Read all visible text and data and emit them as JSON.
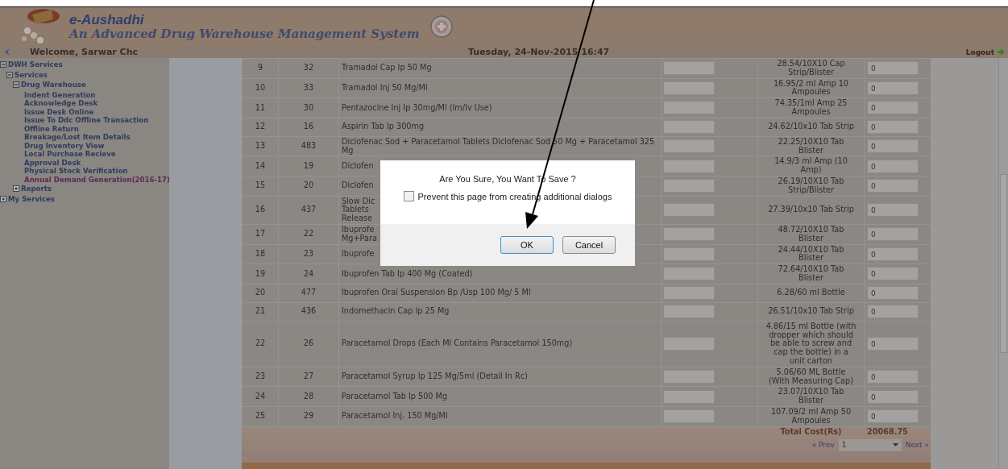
{
  "header": {
    "app_name": "e-Aushadhi",
    "tagline": "An Advanced Drug Warehouse Management System"
  },
  "welcome": "Welcome, Sarwar Chc",
  "datetime": "Tuesday, 24-Nov-2015 16:47",
  "logout": "Logout",
  "sidebar": {
    "items": [
      {
        "label": "DWH Services",
        "expanded": true,
        "children": [
          {
            "label": "Services",
            "expanded": true,
            "children": [
              {
                "label": "Drug Warehouse",
                "expanded": true,
                "children": [
                  {
                    "label": "Indent Generation",
                    "selected": false
                  },
                  {
                    "label": "Acknowledge Desk",
                    "selected": false
                  },
                  {
                    "label": "Issue Desk Online",
                    "selected": false
                  },
                  {
                    "label": "Issue To Ddc Offline Transaction",
                    "selected": false
                  },
                  {
                    "label": "Offline Return",
                    "selected": false
                  },
                  {
                    "label": "Breakage/Lost Item Details",
                    "selected": false
                  },
                  {
                    "label": "Drug Inventory View",
                    "selected": false
                  },
                  {
                    "label": "Local Purchase Recieve",
                    "selected": false
                  },
                  {
                    "label": "Approval Desk",
                    "selected": false
                  },
                  {
                    "label": "Physical Stock Verification",
                    "selected": false
                  },
                  {
                    "label": "Annual Demand Generation(2016-17)",
                    "selected": true
                  }
                ]
              },
              {
                "label": "Reports",
                "expanded": false
              }
            ]
          }
        ]
      },
      {
        "label": "My Services",
        "expanded": false
      }
    ]
  },
  "table": {
    "rows": [
      {
        "sno": "9",
        "code": "32",
        "name": "Tramadol Cap Ip 50 Mg",
        "rate": "28.54/10X10 Cap Strip/Blister",
        "qty": "0"
      },
      {
        "sno": "10",
        "code": "33",
        "name": "Tramadol Inj 50 Mg/Ml",
        "rate": "16.95/2 ml Amp 10 Ampoules",
        "qty": "0"
      },
      {
        "sno": "11",
        "code": "30",
        "name": "Pentazocine Inj Ip 30mg/Ml (Im/Iv Use)",
        "rate": "74.35/1ml Amp 25 Ampoules",
        "qty": "0"
      },
      {
        "sno": "12",
        "code": "16",
        "name": "Aspirin Tab Ip 300mg",
        "rate": "24.62/10x10 Tab Strip",
        "qty": "0"
      },
      {
        "sno": "13",
        "code": "483",
        "name": "Diclofenac Sod + Paracetamol Tablets Diclofenac Sod 50 Mg + Paracetamol 325 Mg",
        "rate": "22.25/10X10 Tab Blister",
        "qty": "0"
      },
      {
        "sno": "14",
        "code": "19",
        "name": "Diclofen",
        "rate": "14.9/3 ml Amp (10 Amp)",
        "qty": "0"
      },
      {
        "sno": "15",
        "code": "20",
        "name": "Diclofen",
        "rate": "26.19/10X10 Tab Strip/Blister",
        "qty": "0"
      },
      {
        "sno": "16",
        "code": "437",
        "name": "Slow Dic\nTablets\nRelease",
        "rate": "27.39/10x10 Tab Strip",
        "qty": "0"
      },
      {
        "sno": "17",
        "code": "22",
        "name": "Ibuprofe\nMg+Para",
        "rate": "48.72/10X10 Tab Blister",
        "qty": "0"
      },
      {
        "sno": "18",
        "code": "23",
        "name": "Ibuprofe",
        "rate": "24.44/10X10 Tab Blister",
        "qty": "0"
      },
      {
        "sno": "19",
        "code": "24",
        "name": "Ibuprofen Tab Ip 400 Mg (Coated)",
        "rate": "72.64/10X10 Tab Blister",
        "qty": "0"
      },
      {
        "sno": "20",
        "code": "477",
        "name": "Ibuprofen Oral Suspension Bp /Usp 100 Mg/ 5 Ml",
        "rate": "6.28/60 ml Bottle",
        "qty": "0"
      },
      {
        "sno": "21",
        "code": "436",
        "name": "Indomethacin Cap Ip 25 Mg",
        "rate": "26.51/10x10 Tab Strip",
        "qty": "0"
      },
      {
        "sno": "22",
        "code": "26",
        "name": "Paracetamol Drops (Each Ml Contains Paracetamol 150mg)",
        "rate": "4.86/15 ml Bottle (with dropper which should be able to screw and cap the bottle) in a unit carton",
        "qty": "0"
      },
      {
        "sno": "23",
        "code": "27",
        "name": "Paracetamol Syrup Ip 125 Mg/5ml (Detail In Rc)",
        "rate": "5.06/60 ML Bottle (With Measuring Cap)",
        "qty": "0"
      },
      {
        "sno": "24",
        "code": "28",
        "name": "Paracetamol Tab Ip 500 Mg",
        "rate": "23.07/10X10 Tab Blister",
        "qty": "0"
      },
      {
        "sno": "25",
        "code": "29",
        "name": "Paracetamol Inj. 150 Mg/Ml",
        "rate": "107.09/2 ml Amp 50 Ampoules",
        "qty": "0"
      }
    ],
    "total_label": "Total Cost(Rs)",
    "total_value": "20068.75"
  },
  "pagination": {
    "prev": "« Prev",
    "page": "1",
    "next": "Next »"
  },
  "dialog": {
    "message": "Are You Sure, You Want To Save ?",
    "checkbox": {
      "label": "Prevent this page from creating additional dialogs",
      "checked": false
    },
    "buttons": [
      {
        "label": "OK",
        "kind": "primary"
      },
      {
        "label": "Cancel",
        "kind": "secondary"
      }
    ]
  }
}
